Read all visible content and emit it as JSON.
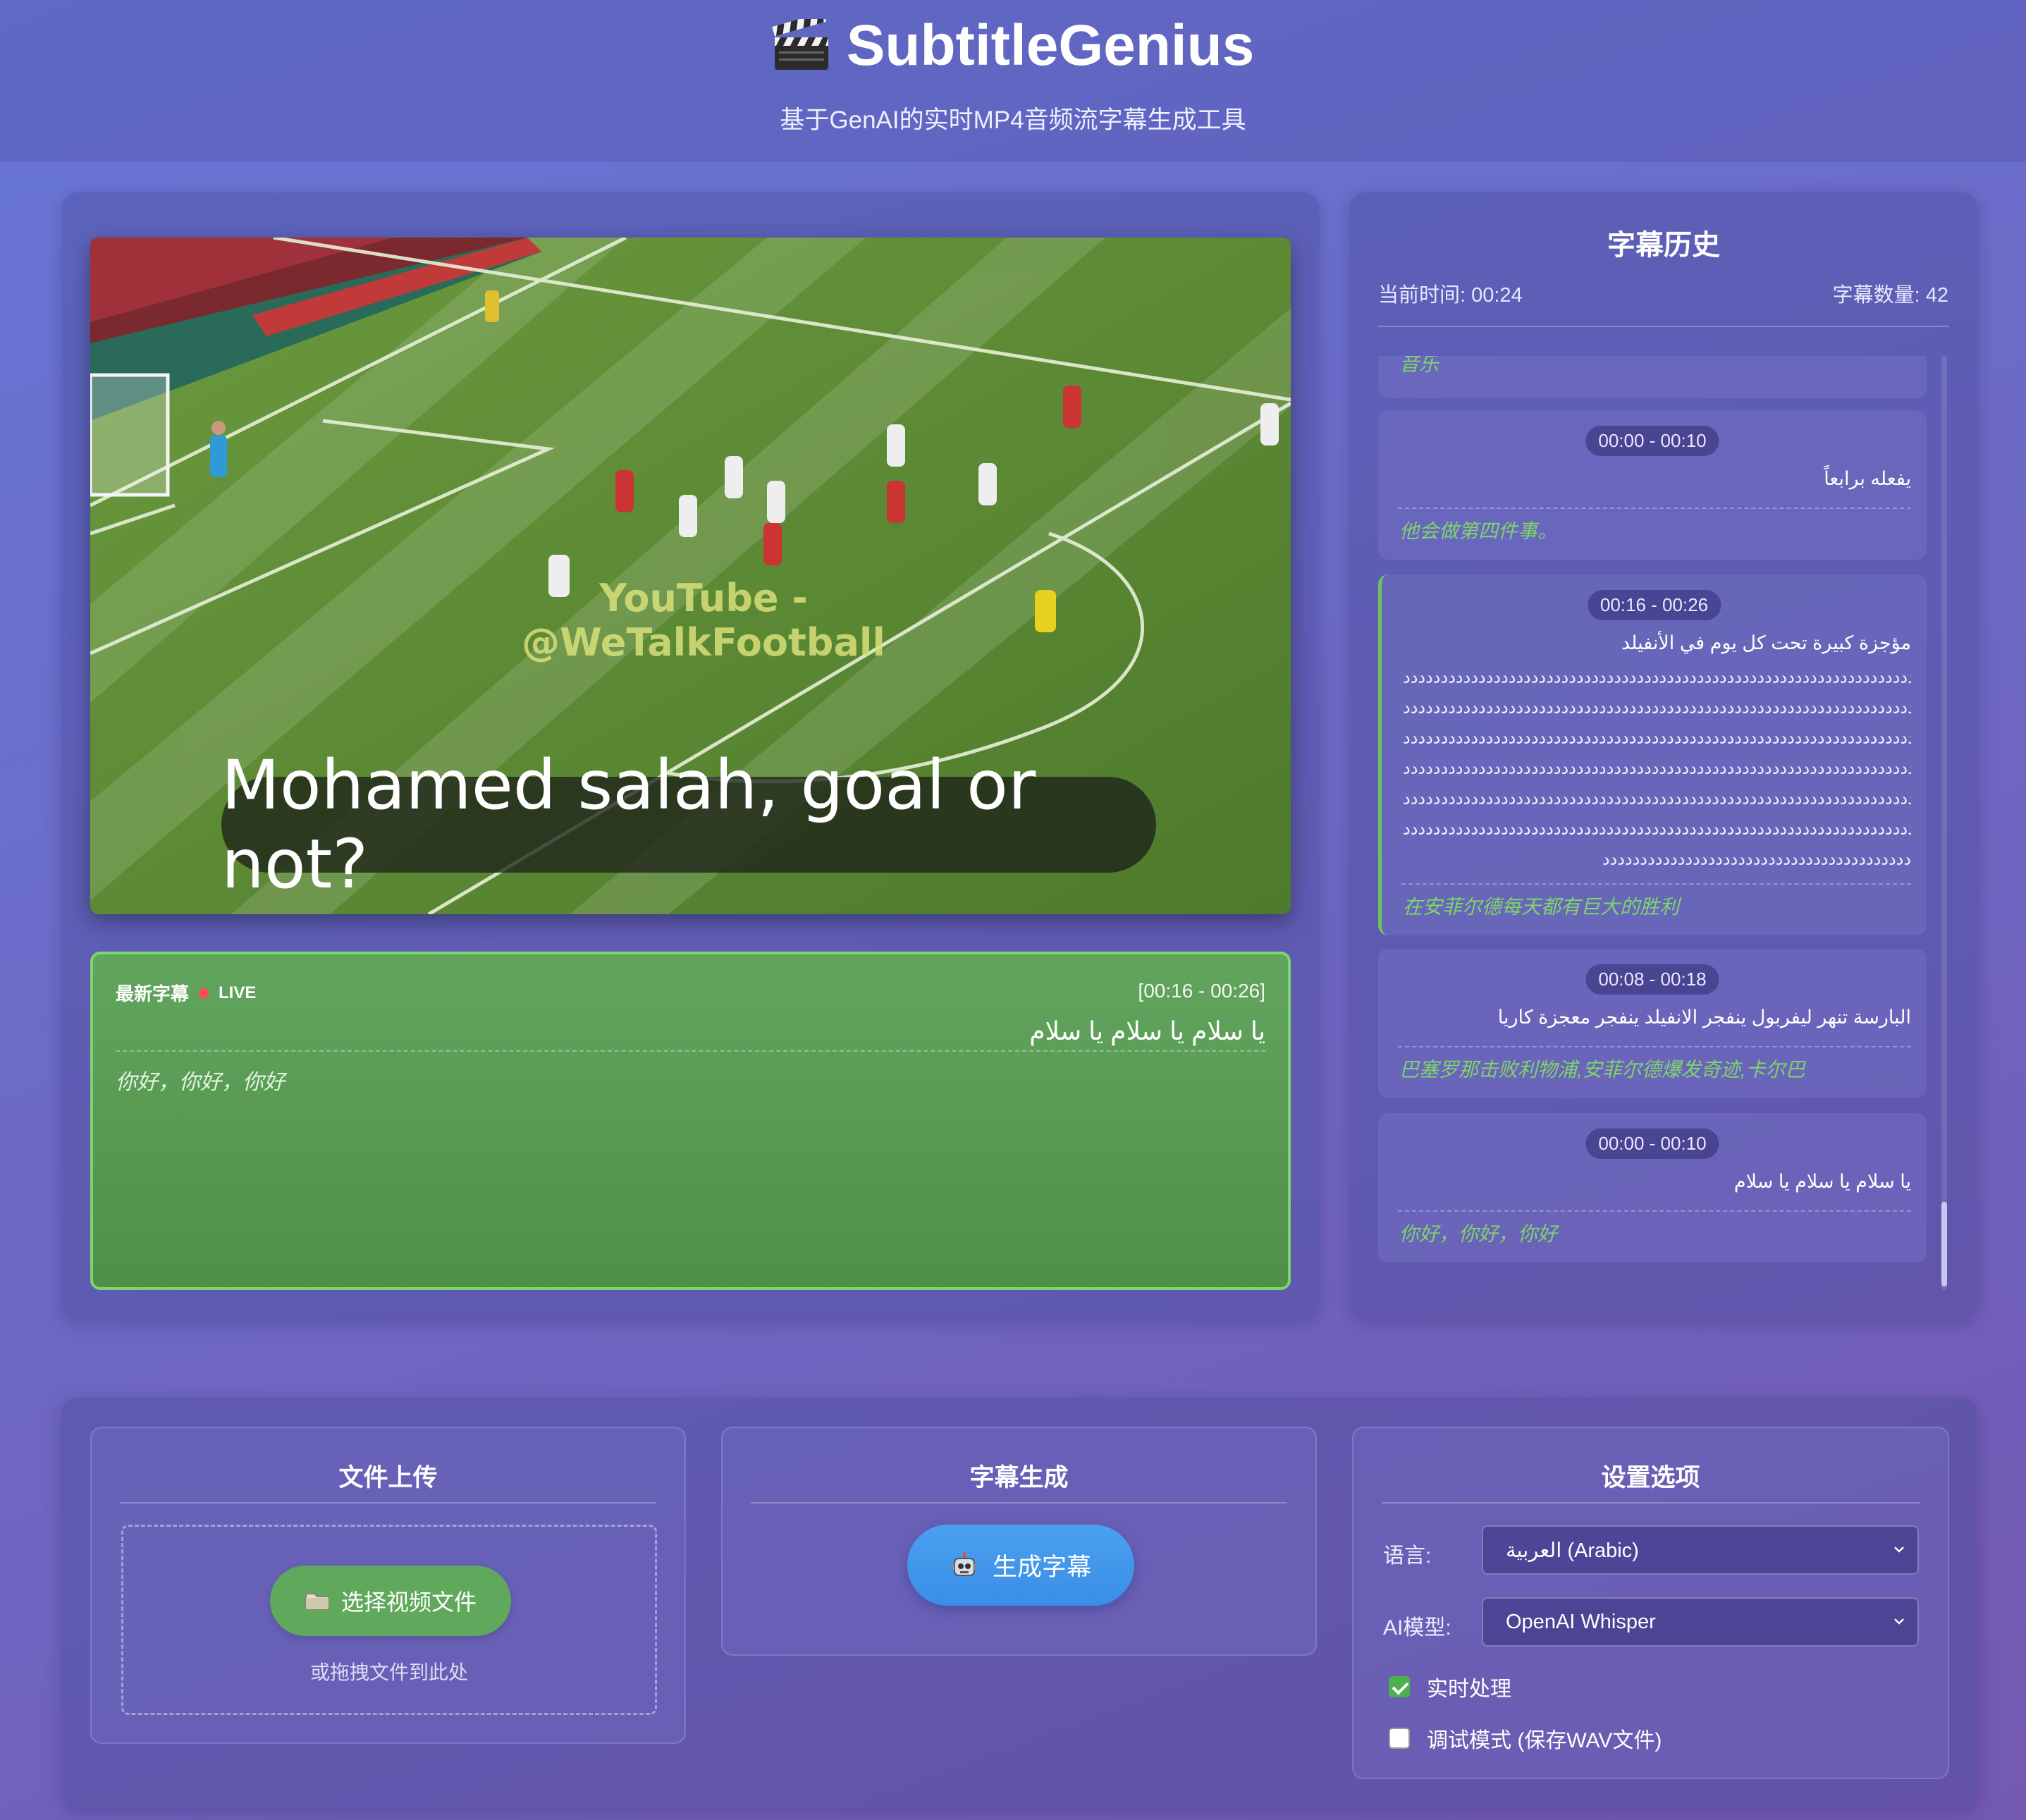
{
  "header": {
    "title": "SubtitleGenius",
    "subtitle": "基于GenAI的实时MP4音频流字幕生成工具",
    "logo_icon": "clapperboard-icon"
  },
  "video": {
    "watermark": "YouTube - @WeTalkFootball",
    "caption": "Mohamed salah, goal or not?"
  },
  "latest": {
    "label": "最新字幕",
    "live": "LIVE",
    "time": "[00:16 - 00:26]",
    "arabic": "يا سلام يا سلام يا سلام",
    "chinese": "你好，你好，你好"
  },
  "history": {
    "title": "字幕历史",
    "current_time": "当前时间: 00:24",
    "count": "字幕数量: 42",
    "items": [
      {
        "chinese": "音乐"
      },
      {
        "time": "00:00 - 00:10",
        "arabic": "يفعله برابعاً",
        "chinese": "他会做第四件事。"
      },
      {
        "time": "00:16 - 00:26",
        "arabic": "مؤجزة كبيرة تحت كل يوم في الأنفيلد",
        "repeat": "دددددددددددددددددددددددددددددددددددددددددددددددددددددددددددددددددددددددددددددددددددددد",
        "repeat_last": "ددددددددددددددددددددددددددددددددددددددددد",
        "chinese": "在安菲尔德每天都有巨大的胜利"
      },
      {
        "time": "00:08 - 00:18",
        "arabic": "البارسة تنهر ليفربول ينفجر الانفيلد ينفجر معجزة كاريا",
        "chinese": "巴塞罗那击败利物浦,安菲尔德爆发奇迹,卡尔巴"
      },
      {
        "time": "00:00 - 00:10",
        "arabic": "يا سلام يا سلام يا سلام",
        "chinese": "你好，你好，你好"
      }
    ]
  },
  "upload": {
    "title": "文件上传",
    "button": "选择视频文件",
    "hint": "或拖拽文件到此处"
  },
  "generate": {
    "title": "字幕生成",
    "button": "生成字幕"
  },
  "settings": {
    "title": "设置选项",
    "language_label": "语言:",
    "language_value": "العربية (Arabic)",
    "model_label": "AI模型:",
    "model_value": "OpenAI Whisper",
    "realtime_label": "实时处理",
    "realtime_checked": true,
    "debug_label": "调试模式 (保存WAV文件)",
    "debug_checked": false
  },
  "colors": {
    "accent_green": "#5fa85c",
    "accent_blue": "#3a8ee6",
    "chinese_text": "#7fd46b"
  }
}
